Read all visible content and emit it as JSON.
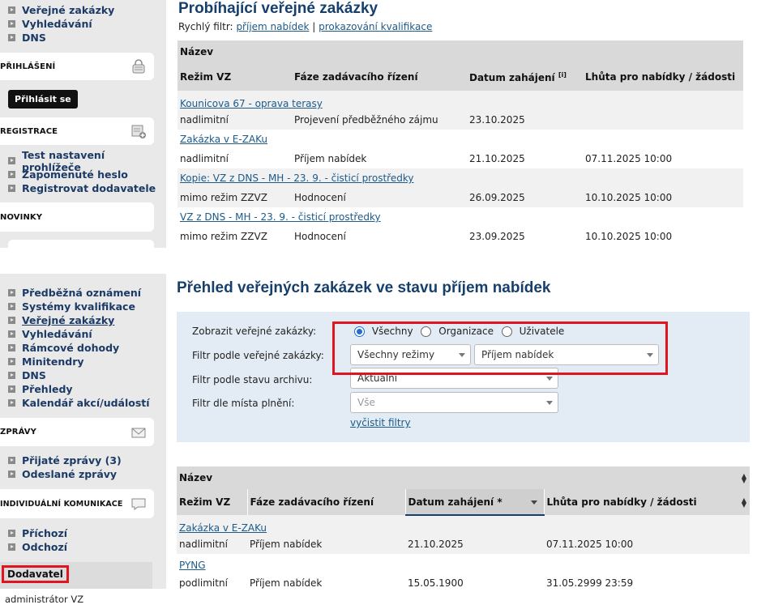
{
  "top_sidebar": {
    "nav1": [
      "Veřejné zakázky",
      "Vyhledávání",
      "DNS"
    ],
    "login_title": "PŘIHLÁŠENÍ",
    "login_button": "Přihlásit se",
    "register_title": "REGISTRACE",
    "nav2": [
      "Test nastavení prohlížeče",
      "Zapomenuté heslo",
      "Registrovat dodavatele"
    ],
    "news_title": "NOVINKY"
  },
  "top_main": {
    "title": "Probíhající veřejné zakázky",
    "quick_filter_label": "Rychlý filtr:",
    "quick_filter_links": [
      "příjem nabídek",
      "prokazování kvalifikace"
    ],
    "quick_sep": "|",
    "head_name": "Název",
    "columns": [
      "Režim VZ",
      "Fáze zadávacího řízení",
      "Datum zahájení",
      "Lhůta pro nabídky / žádosti"
    ],
    "info_marker": "[i]",
    "rows": [
      {
        "name": "Kounicova 67 - oprava terasy",
        "mode": "nadlimitní",
        "phase": "Projevení předběžného zájmu",
        "date": "23.10.2025",
        "deadline": ""
      },
      {
        "name": "Zakázka v E-ZAKu",
        "mode": "nadlimitní",
        "phase": "Příjem nabídek",
        "date": "21.10.2025",
        "deadline": "07.11.2025 10:00"
      },
      {
        "name": "Kopie: VZ z DNS - MH - 23. 9. - čisticí prostředky",
        "mode": "mimo režim ZZVZ",
        "phase": "Hodnocení",
        "date": "26.09.2025",
        "deadline": "10.10.2025 10:00"
      },
      {
        "name": "VZ z DNS - MH - 23. 9. - čisticí prostředky",
        "mode": "mimo režim ZZVZ",
        "phase": "Hodnocení",
        "date": "23.09.2025",
        "deadline": "10.10.2025 10:00"
      }
    ]
  },
  "bottom_sidebar": {
    "nav1": [
      "Předběžná oznámení",
      "Systémy kvalifikace",
      "Veřejné zakázky",
      "Vyhledávání",
      "Rámcové dohody",
      "Minitendry",
      "DNS",
      "Přehledy",
      "Kalendář akcí/událostí"
    ],
    "messages_title": "ZPRÁVY",
    "nav2": [
      "Přijaté zprávy (3)",
      "Odeslané zprávy"
    ],
    "indiv_title": "INDIVIDUÁLNÍ KOMUNIKACE",
    "nav3": [
      "Příchozí",
      "Odchozí"
    ],
    "role": "Dodavatel",
    "user": "administrátor VZ"
  },
  "bottom_main": {
    "title": "Přehled veřejných zakázek ve stavu příjem nabídek",
    "filters": {
      "show_label": "Zobrazit veřejné zakázky:",
      "radio_options": [
        "Všechny",
        "Organizace",
        "Uživatele"
      ],
      "radio_selected": "Všechny",
      "vz_label": "Filtr podle veřejné zakázky:",
      "mode_value": "Všechny režimy",
      "phase_value": "Příjem nabídek",
      "archive_label": "Filtr podle stavu archivu:",
      "archive_value": "Aktuální",
      "place_label": "Filtr dle místa plnění:",
      "place_value": "Vše",
      "clear_link": "vyčistit filtry"
    },
    "head_name": "Název",
    "columns": [
      "Režim VZ",
      "Fáze zadávacího řízení",
      "Datum zahájení *",
      "Lhůta pro nabídky / žádosti"
    ],
    "rows": [
      {
        "name": "Zakázka v E-ZAKu",
        "mode": "nadlimitní",
        "phase": "Příjem nabídek",
        "date": "21.10.2025",
        "deadline": "07.11.2025 10:00"
      },
      {
        "name": "PYNG",
        "mode": "podlimitní",
        "phase": "Příjem nabídek",
        "date": "15.05.1900",
        "deadline": "31.05.2999 23:59"
      }
    ]
  }
}
